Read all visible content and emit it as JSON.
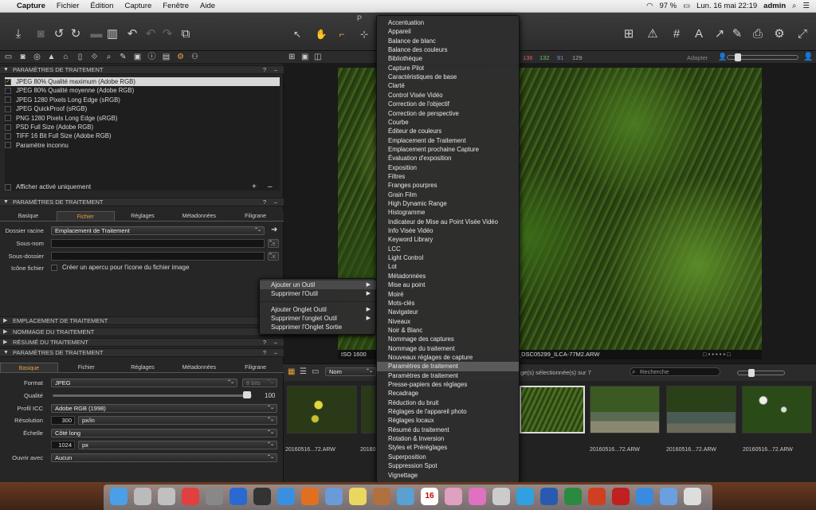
{
  "menubar": {
    "apple": "",
    "app": "Capture",
    "items": [
      "Fichier",
      "Édition",
      "Capture",
      "Fenêtre",
      "Aide"
    ],
    "battery": "97 %",
    "clock": "Lun. 16 mai  22:19",
    "user": "admin"
  },
  "window": {
    "title_fragment": "P"
  },
  "toolbar": {
    "left_icons": [
      "import-icon",
      "camera-icon",
      "rotate-left-icon",
      "rotate-right-icon",
      "folder-icon",
      "trash-icon",
      "undo-icon",
      "redo-left-icon",
      "redo-right-icon",
      "copy-icon"
    ],
    "center_icons": [
      "cursor-icon",
      "pan-icon",
      "crop-icon",
      "straighten-icon"
    ],
    "right_icons": [
      "grid-icon",
      "warning-icon",
      "grid-lines-icon",
      "text-icon",
      "arrow-icon",
      "pencil-icon",
      "print-icon",
      "settings-icon",
      "fullscreen-icon"
    ]
  },
  "viewbar": {
    "values": [
      "136",
      "132",
      "91",
      "129"
    ],
    "adapt": "Adapter"
  },
  "left": {
    "section1": {
      "title": "PARAMÈTRES DE TRAITEMENT",
      "q": "?",
      "dash": "–",
      "recipes": [
        {
          "label": "JPEG 80% Qualité maximum (Adobe RGB)",
          "checked": "✓",
          "selected": true
        },
        {
          "label": "JPEG 80% Qualité moyenne (Adobe RGB)",
          "checked": "",
          "selected": false
        },
        {
          "label": "JPEG 1280 Pixels Long Edge (sRGB)",
          "checked": "",
          "selected": false
        },
        {
          "label": "JPEG QuickProof (sRGB)",
          "checked": "",
          "selected": false
        },
        {
          "label": "PNG 1280 Pixels Long Edge (sRGB)",
          "checked": "",
          "selected": false
        },
        {
          "label": "PSD Full Size (Adobe RGB)",
          "checked": "",
          "selected": false
        },
        {
          "label": "TIFF 16 Bit Full Size (Adobe RGB)",
          "checked": "",
          "selected": false
        },
        {
          "label": "Paramètre inconnu",
          "checked": "",
          "selected": false
        }
      ],
      "show_active": "Afficher activé uniquement",
      "plus": "+",
      "minus": "–"
    },
    "section2": {
      "title": "PARAMÈTRES DE TRAITEMENT",
      "q": "?",
      "dash": "–",
      "tabs": [
        "Basique",
        "Fichier",
        "Réglages",
        "Métadonnées",
        "Filigrane"
      ],
      "dossier_racine_label": "Dossier racine",
      "dossier_racine_value": "Emplacement de Traitement",
      "sous_nom_label": "Sous-nom",
      "sous_dossier_label": "Sous-dossier",
      "icone_label": "Icône fichier",
      "icone_text": "Créer un apercu pour l'icone du fichier image",
      "more": "..."
    },
    "collapsed": [
      {
        "title": "EMPLACEMENT DE TRAITEMENT",
        "q": "",
        "dash": ""
      },
      {
        "title": "NOMMAGE DU TRAITEMENT",
        "q": "",
        "dash": ""
      },
      {
        "title": "RÉSUMÉ DU TRAITEMENT",
        "q": "?",
        "dash": "–"
      }
    ],
    "section3": {
      "title": "PARAMÈTRES DE TRAITEMENT",
      "q": "?",
      "dash": "–",
      "tabs": [
        "Basique",
        "Fichier",
        "Réglages",
        "Métadonnées",
        "Filigrane"
      ],
      "format_label": "Format",
      "format_value": "JPEG",
      "bits": "8 bits",
      "qualite_label": "Qualité",
      "qualite_value": "100",
      "profil_label": "Profil ICC",
      "profil_value": "Adobe RGB (1998)",
      "resolution_label": "Résolution",
      "resolution_value": "300",
      "resolution_unit": "px/in",
      "echelle_label": "Échelle",
      "echelle_value": "Côté long",
      "echelle_num": "1024",
      "echelle_unit": "px",
      "ouvrir_label": "Ouvrir avec",
      "ouvrir_value": "Aucun"
    }
  },
  "viewer": {
    "iso": "ISO 1600",
    "filename": "_DSC05299_ILCA-77M2.ARW"
  },
  "browser": {
    "sort": "Nom",
    "count": "ge(s) sélectionnée(s) sur 7",
    "search": "Recherche",
    "thumbs": [
      "20160516...72.ARW",
      "20160516",
      "",
      "20160516...72.ARW",
      "20160516...72.ARW",
      "20160516...72.ARW",
      "20160516...72.ARW"
    ]
  },
  "context_menu": {
    "items": [
      {
        "label": "Ajouter un Outil",
        "sub": "▶",
        "hl": true
      },
      {
        "label": "Supprimer l'Outil",
        "sub": "▶",
        "hl": false
      },
      {
        "label": "Ajouter Onglet Outil",
        "sub": "▶",
        "hl": false
      },
      {
        "label": "Supprimer l'onglet Outil",
        "sub": "▶",
        "hl": false
      },
      {
        "label": "Supprimer l'Onglet Sortie",
        "sub": "",
        "hl": false
      }
    ]
  },
  "submenu": {
    "items": [
      "Accentuation",
      "Appareil",
      "Balance de blanc",
      "Balance des couleurs",
      "Bibliothèque",
      "Capture Pilot",
      "Caractéristiques de base",
      "Clarté",
      "Control Visée Vidéo",
      "Correction de l'objectif",
      "Correction de perspective",
      "Courbe",
      "Éditeur de couleurs",
      "Emplacement de Traitement",
      "Emplacement prochaine Capture",
      "Évaluation d'exposition",
      "Exposition",
      "Filtres",
      "Franges pourpres",
      "Grain Film",
      "High Dynamic Range",
      "Histogramme",
      "Indicateur de Mise au Point Visée Vidéo",
      "Info Visée Vidéo",
      "Keyword Library",
      "LCC",
      "Light Control",
      "Lot",
      "Métadonnées",
      "Mise au point",
      "Moiré",
      "Mots-clés",
      "Navigateur",
      "Niveaux",
      "Noir & Blanc",
      "Nommage des captures",
      "Nommage du traitement",
      "Nouveaux réglages de capture",
      "Paramètres de traitement",
      "Paramètres de traitement",
      "Presse-papiers des réglages",
      "Recadrage",
      "Réduction du bruit",
      "Réglages de l'appareil photo",
      "Réglages locaux",
      "Résumé du traitement",
      "Rotation & Inversion",
      "Styles et Préréglages",
      "Superposition",
      "Suppression Spot",
      "Vignettage"
    ],
    "highlight_index": 38
  },
  "dock": {
    "icons": [
      "finder-icon",
      "launchpad-icon",
      "rocket-icon",
      "tdx-icon",
      "camera-app-icon",
      "teamviewer-icon",
      "capture-icon",
      "safari-icon",
      "firefox-icon",
      "mail-icon",
      "notes-icon",
      "books-icon",
      "preview-icon",
      "calendar-icon",
      "photos-icon",
      "itunes-icon",
      "usb-icon",
      "skype-icon",
      "word-icon",
      "excel-icon",
      "powerpoint-icon",
      "acrobat-icon",
      "appstore-icon",
      "folder-icon",
      "trash-icon"
    ],
    "calendar_day": "16"
  }
}
